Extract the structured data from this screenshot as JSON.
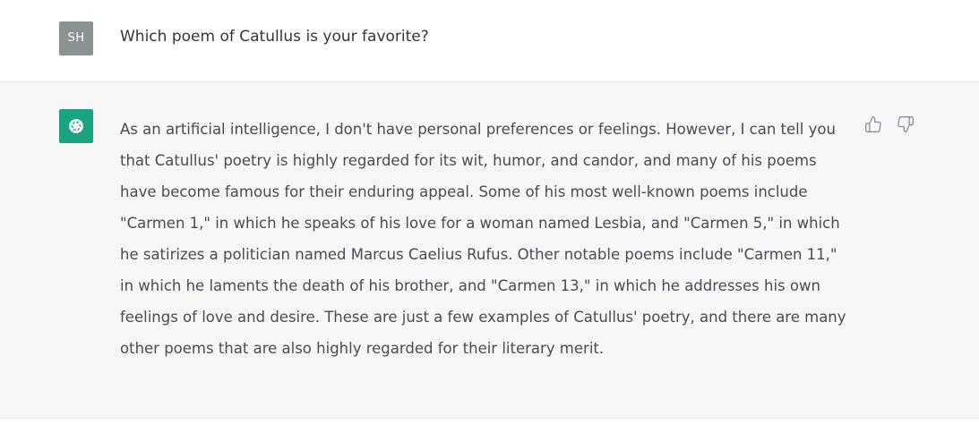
{
  "user": {
    "avatar_initials": "SH",
    "message": "Which poem of Catullus is your favorite?"
  },
  "assistant": {
    "avatar_icon": "openai-logo-icon",
    "message": "As an artificial intelligence, I don't have personal preferences or feelings. However, I can tell you that Catullus' poetry is highly regarded for its wit, humor, and candor, and many of his poems have become famous for their enduring appeal. Some of his most well-known poems include \"Carmen 1,\" in which he speaks of his love for a woman named Lesbia, and \"Carmen 5,\" in which he satirizes a politician named Marcus Caelius Rufus. Other notable poems include \"Carmen 11,\" in which he laments the death of his brother, and \"Carmen 13,\" in which he addresses his own feelings of love and desire. These are just a few examples of Catullus' poetry, and there are many other poems that are also highly regarded for their literary merit.",
    "feedback": {
      "thumbs_up_icon": "thumbs-up-icon",
      "thumbs_down_icon": "thumbs-down-icon"
    }
  },
  "colors": {
    "user_avatar_bg": "#8b9294",
    "assistant_avatar_bg": "#19a37f",
    "assistant_row_bg": "#f7f7f8",
    "text": "#343541"
  }
}
